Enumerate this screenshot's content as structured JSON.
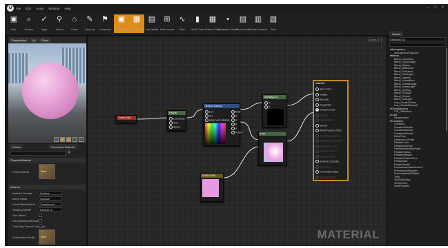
{
  "titlebar": {
    "logo": "U",
    "menu": [
      "File",
      "Edit",
      "Asset",
      "Window",
      "Help"
    ],
    "window_controls": [
      "–",
      "□",
      "×"
    ]
  },
  "toolbar": {
    "buttons": [
      {
        "label": "Save",
        "icon": "save-icon",
        "glyph": "▣"
      },
      {
        "label": "Browse",
        "icon": "browse-icon",
        "glyph": "⌕"
      },
      {
        "label": "Apply",
        "icon": "apply-icon",
        "glyph": "✓"
      },
      {
        "label": "Search",
        "icon": "search-icon",
        "glyph": "⚲"
      },
      {
        "label": "Home",
        "icon": "home-icon",
        "glyph": "⌂"
      },
      {
        "label": "Clean Up",
        "icon": "cleanup-icon",
        "glyph": "✎"
      },
      {
        "label": "Connectors",
        "icon": "connectors-icon",
        "glyph": "⚑"
      },
      {
        "label": "Live Preview",
        "icon": "live-preview-icon",
        "glyph": "▣",
        "active": true
      },
      {
        "label": "Live Nodes",
        "icon": "live-nodes-icon",
        "glyph": "▦",
        "active": true
      },
      {
        "label": "Live Update",
        "icon": "live-update-icon",
        "glyph": "▤"
      },
      {
        "label": "Hide Unused",
        "icon": "hide-unused-icon",
        "glyph": "⊞"
      },
      {
        "label": "Stats",
        "icon": "stats-icon",
        "glyph": "∿"
      },
      {
        "label": "Mobile Stats",
        "icon": "mobile-stats-icon",
        "glyph": "▮"
      },
      {
        "label": "Platform Stats",
        "icon": "platform-stats-icon",
        "glyph": "▦"
      },
      {
        "label": "Parameter Defaults",
        "icon": "parameter-defaults-icon",
        "glyph": "•"
      },
      {
        "label": "Find Results",
        "icon": "find-results-icon",
        "glyph": "▤"
      },
      {
        "label": "Preview Viewport",
        "icon": "preview-viewport-icon",
        "glyph": "▥"
      },
      {
        "label": "Tabs",
        "icon": "tabs-icon",
        "glyph": "▧"
      }
    ]
  },
  "viewport": {
    "buttons": [
      "Perspective",
      "Lit",
      "Show"
    ],
    "icons": [
      "view-mode-icon",
      "light-icon",
      "sphere-icon",
      "cube-icon",
      "cylinder-icon"
    ]
  },
  "details": {
    "tabs": [
      "Details",
      "Parameter Defaults"
    ],
    "sections": [
      {
        "title": "Physical Material",
        "rows": [
          {
            "key": "Phys Material",
            "type": "thumb",
            "value": "None"
          }
        ]
      },
      {
        "title": "Material",
        "rows": [
          {
            "key": "Material Domain",
            "type": "select",
            "value": "Surface"
          },
          {
            "key": "Blend Mode",
            "type": "select",
            "value": "Opaque"
          },
          {
            "key": "Decal Blend Mode",
            "type": "select",
            "value": "Translucent"
          },
          {
            "key": "Shading Model",
            "type": "select",
            "value": "Default Lit"
          },
          {
            "key": "Two Sided",
            "type": "check"
          },
          {
            "key": "Use Material Attributes",
            "type": "check"
          },
          {
            "key": "Cast Ray Traced Shadows",
            "type": "check"
          },
          {
            "key": "Subsurface Profile",
            "type": "thumb",
            "value": "None"
          }
        ]
      }
    ]
  },
  "graph": {
    "zoom": "Zoom 1:1",
    "watermark": "MATERIAL",
    "nodes": [
      {
        "id": "time",
        "title": "Time/Cos(t)",
        "color": "#a5271d"
      },
      {
        "id": "panner",
        "title": "Panner",
        "color": "#47683e",
        "pins": [
          "Coordinate",
          "Time",
          "Speed"
        ]
      },
      {
        "id": "texsample",
        "title": "Texture Sample",
        "color": "#2c4f7f",
        "pins_in": [
          "UVs",
          "Tex",
          "Apply View MipBias"
        ],
        "pins_out": [
          "RGB",
          "R",
          "G",
          "B",
          "A",
          "RGBA"
        ]
      },
      {
        "id": "multiply",
        "title": "Multiply(1,0)",
        "color": "#47683e",
        "pins": [
          "A",
          "B"
        ]
      },
      {
        "id": "lerp",
        "title": "Lerp",
        "color": "#47683e",
        "pins": [
          "A",
          "B",
          "Alpha"
        ]
      },
      {
        "id": "vec",
        "title": "0.845,0.408",
        "color": "#6b5b1d"
      },
      {
        "id": "result",
        "title": "Material",
        "pins": [
          "Base Color",
          "Metallic",
          "Specular",
          "Roughness",
          "Emissive Color",
          "Opacity",
          "Opacity Mask",
          "Normal",
          "World Position Offset",
          "World Displacement",
          "Tessellation Multiplier",
          "Subsurface Color",
          "Custom Data 0",
          "Custom Data 1",
          "Ambient Occlusion",
          "Refraction",
          "Pixel Depth Offset",
          "Shading Model"
        ],
        "active": [
          "Base Color",
          "Metallic",
          "Specular",
          "Roughness",
          "Emissive Color",
          "Normal",
          "World Position Offset",
          "Ambient Occlusion",
          "Pixel Depth Offset"
        ]
      }
    ]
  },
  "palette": {
    "tab": "Palette",
    "category_label": "Category",
    "category_value": "All",
    "items": [
      {
        "t": "h",
        "label": "Atmosphere"
      },
      {
        "t": "i",
        "label": "AtmosphericFogColor"
      },
      {
        "t": "h",
        "label": "Blends"
      },
      {
        "t": "i",
        "label": "Blend_ColorBurn"
      },
      {
        "t": "i",
        "label": "Blend_ColorDodge"
      },
      {
        "t": "i",
        "label": "Blend_Darken"
      },
      {
        "t": "i",
        "label": "Blend_Difference"
      },
      {
        "t": "i",
        "label": "Blend_Exclusion"
      },
      {
        "t": "i",
        "label": "Blend_HardLight"
      },
      {
        "t": "i",
        "label": "Blend_Lighten"
      },
      {
        "t": "i",
        "label": "Blend_LinearBurn"
      },
      {
        "t": "i",
        "label": "Blend_LinearDodge"
      },
      {
        "t": "i",
        "label": "Blend_LinearLight"
      },
      {
        "t": "i",
        "label": "Blend_Overlay"
      },
      {
        "t": "i",
        "label": "Blend_PinLight"
      },
      {
        "t": "i",
        "label": "Blend_Screen"
      },
      {
        "t": "i",
        "label": "Blend_SoftLight"
      },
      {
        "t": "i",
        "label": "Lerp_ScratchGrime"
      },
      {
        "t": "i",
        "label": "Lerp_ScratchGrime2"
      },
      {
        "t": "h",
        "label": "Chromakeying"
      },
      {
        "t": "i",
        "label": "CIE_Difference"
      },
      {
        "t": "h",
        "label": "Color"
      },
      {
        "t": "i",
        "label": "Desaturation"
      },
      {
        "t": "h",
        "label": "Constants"
      },
      {
        "t": "i",
        "label": "Constant"
      },
      {
        "t": "i",
        "label": "Constant2Vector"
      },
      {
        "t": "i",
        "label": "Constant3Vector"
      },
      {
        "t": "i",
        "label": "Constant4Vector"
      },
      {
        "t": "i",
        "label": "DeltaTime"
      },
      {
        "t": "i",
        "label": "DistanceCullFade"
      },
      {
        "t": "i",
        "label": "ParticleColor"
      },
      {
        "t": "i",
        "label": "ParticleDirection"
      },
      {
        "t": "i",
        "label": "ParticleMotionBlurFade"
      },
      {
        "t": "i",
        "label": "ParticleRadius"
      },
      {
        "t": "i",
        "label": "ParticleRandom"
      },
      {
        "t": "i",
        "label": "ParticleRelativeTime"
      },
      {
        "t": "i",
        "label": "ParticleSize"
      },
      {
        "t": "i",
        "label": "ParticleSpeed"
      },
      {
        "t": "i",
        "label": "PerInstanceFadeAmount"
      },
      {
        "t": "i",
        "label": "PerInstanceRandom"
      },
      {
        "t": "i",
        "label": "PrecomputedAOMask"
      },
      {
        "t": "i",
        "label": "Time"
      },
      {
        "t": "i",
        "label": "TwoSidedSign"
      },
      {
        "t": "i",
        "label": "VertexColor"
      },
      {
        "t": "i",
        "label": "ViewProperty"
      }
    ]
  }
}
